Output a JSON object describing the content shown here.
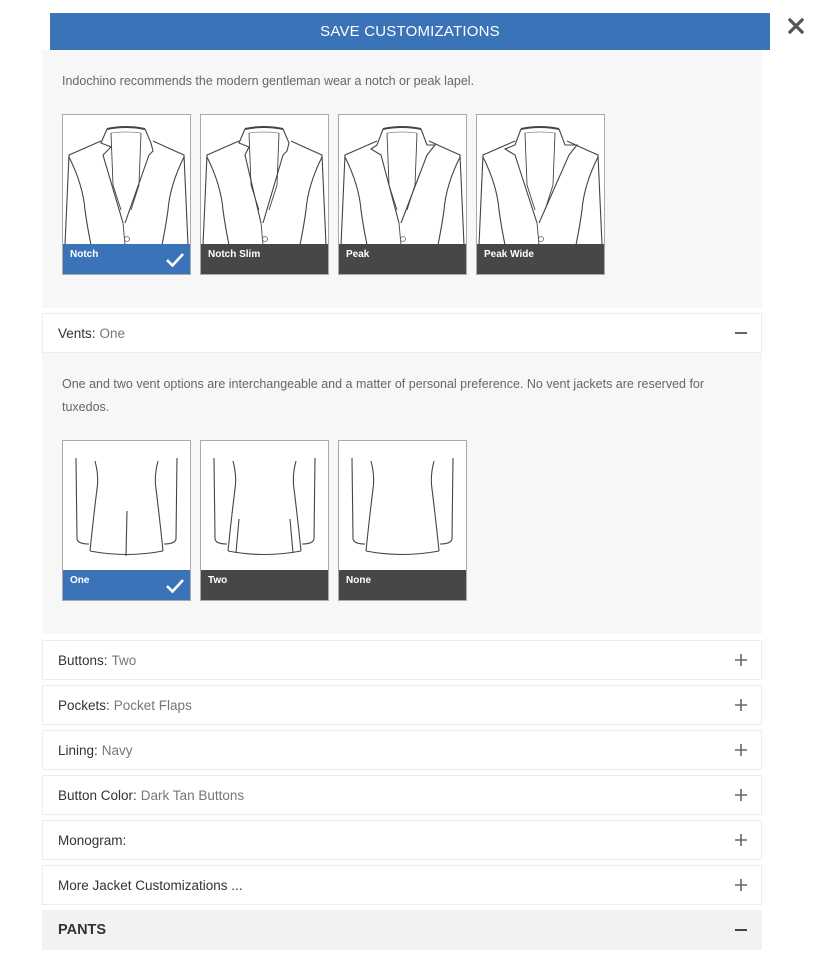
{
  "header": {
    "save_label": "SAVE CUSTOMIZATIONS",
    "close_icon": "close-icon"
  },
  "colors": {
    "accent": "#3b73b9",
    "label_dark": "#474747",
    "panel_bg": "#f7f7f7",
    "section_bg": "#f2f2f2"
  },
  "lapel": {
    "description": "Indochino recommends the modern gentleman wear a notch or peak lapel.",
    "options": [
      {
        "label": "Notch",
        "selected": true
      },
      {
        "label": "Notch Slim",
        "selected": false
      },
      {
        "label": "Peak",
        "selected": false
      },
      {
        "label": "Peak Wide",
        "selected": false
      }
    ]
  },
  "vents": {
    "title": "Vents:",
    "value": "One",
    "expanded": true,
    "description": "One and two vent options are interchangeable and a matter of personal preference. No vent jackets are reserved for tuxedos.",
    "options": [
      {
        "label": "One",
        "selected": true
      },
      {
        "label": "Two",
        "selected": false
      },
      {
        "label": "None",
        "selected": false
      }
    ]
  },
  "rows": [
    {
      "title": "Buttons:",
      "value": "Two",
      "icon": "plus-icon"
    },
    {
      "title": "Pockets:",
      "value": "Pocket Flaps",
      "icon": "plus-icon"
    },
    {
      "title": "Lining:",
      "value": "Navy",
      "icon": "plus-icon"
    },
    {
      "title": "Button Color:",
      "value": "Dark Tan Buttons",
      "icon": "plus-icon"
    },
    {
      "title": "Monogram:",
      "value": "",
      "icon": "plus-icon"
    },
    {
      "title": "More Jacket Customizations ...",
      "value": "",
      "icon": "plus-icon"
    }
  ],
  "pants_section": {
    "title": "PANTS",
    "expanded": true,
    "icon": "minus-icon"
  }
}
